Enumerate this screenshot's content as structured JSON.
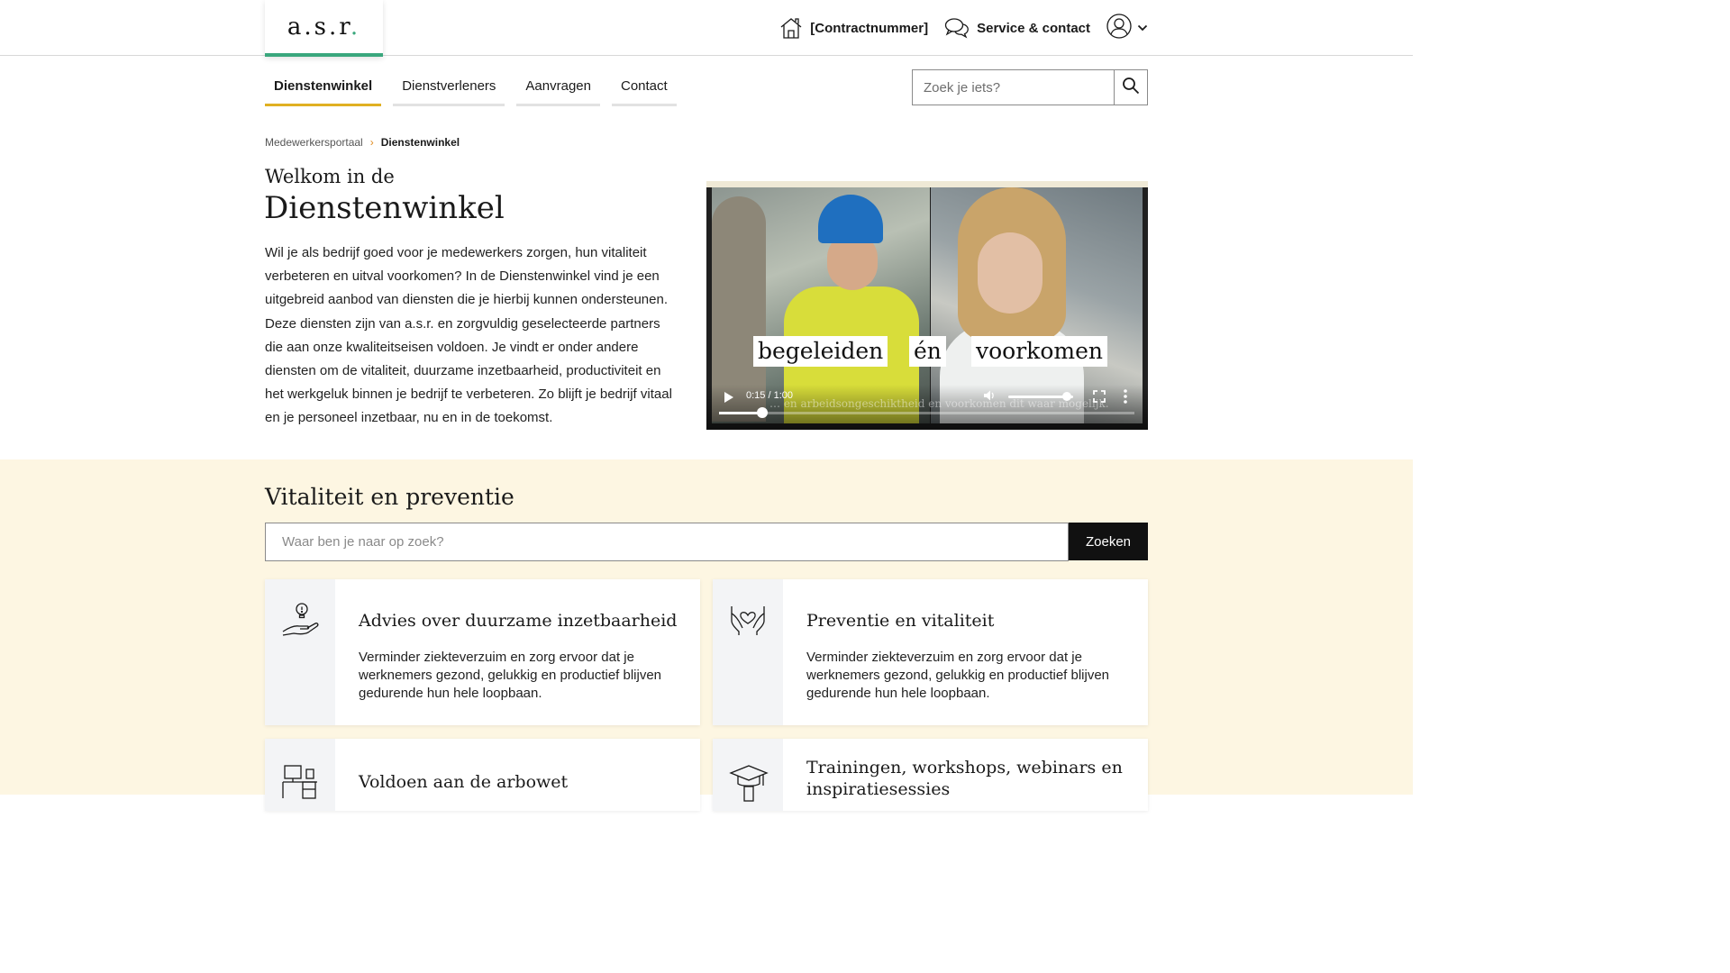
{
  "header": {
    "logo": {
      "letters": "a.s.r",
      "dot": "."
    },
    "contract_label": "[Contractnummer]",
    "service_label": "Service & contact"
  },
  "nav": {
    "items": [
      {
        "label": "Dienstenwinkel",
        "active": true
      },
      {
        "label": "Dienstverleners",
        "active": false
      },
      {
        "label": "Aanvragen",
        "active": false
      },
      {
        "label": "Contact",
        "active": false
      }
    ],
    "search_placeholder": "Zoek je iets?"
  },
  "breadcrumb": {
    "parent": "Medewerkersportaal",
    "separator": "›",
    "current": "Dienstenwinkel"
  },
  "hero": {
    "subtitle": "Welkom in de",
    "title": "Dienstenwinkel",
    "body": "Wil je als bedrijf goed voor je medewerkers zorgen, hun vitaliteit verbeteren en uitval voorkomen? In de Dienstenwinkel vind je een uitgebreid aanbod van diensten die je hierbij kunnen ondersteunen. Deze diensten zijn van a.s.r. en zorgvuldig geselecteerde partners die aan onze kwaliteitseisen voldoen. Je vindt er onder andere diensten om de vitaliteit, duurzame inzetbaarheid, productiviteit en het werkgeluk binnen je bedrijf te verbeteren. Zo blijft je bedrijf vitaal en je personeel inzetbaar, nu en in de toekomst."
  },
  "video": {
    "caption_words": [
      "begeleiden",
      "én",
      "voorkomen"
    ],
    "subtitle_ghost": "… en arbeidsongeschiktheid en voorkomen dit waar mogelijk.",
    "time": "0:15 / 1:00",
    "progress_fraction": 0.105,
    "volume_fraction": 0.9
  },
  "section": {
    "title": "Vitaliteit en preventie",
    "search_placeholder": "Waar ben je naar op zoek?",
    "search_button": "Zoeken",
    "cards": [
      {
        "title": "Advies over duurzame inzetbaarheid",
        "text": "Verminder ziekteverzuim en zorg ervoor dat je werknemers gezond, gelukkig en productief blijven gedurende hun hele loopbaan.",
        "icon": "hand-lightbulb-icon"
      },
      {
        "title": "Preventie en vitaliteit",
        "text": "Verminder ziekteverzuim en zorg ervoor dat je werknemers gezond, gelukkig en productief blijven gedurende hun hele loopbaan.",
        "icon": "hands-heart-icon"
      },
      {
        "title": "Voldoen aan de arbowet",
        "text": "",
        "icon": "desk-icon"
      },
      {
        "title": "Trainingen, workshops, webinars en inspiratiesessies",
        "text": "",
        "icon": "graduation-cap-icon"
      }
    ]
  },
  "colors": {
    "accent_green": "#3aa77d",
    "nav_active_underline": "#e0b022",
    "breadcrumb_separator": "#e08a1e",
    "section_background": "#fdf6e2",
    "button_dark": "#111111"
  }
}
